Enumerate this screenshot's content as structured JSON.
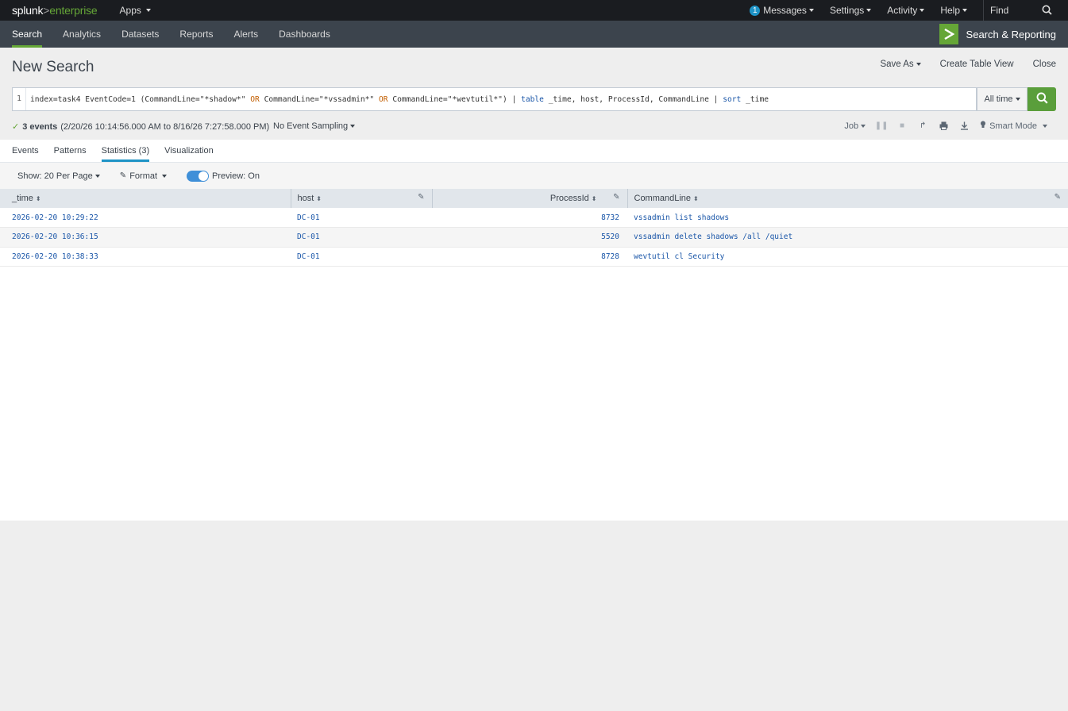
{
  "topbar": {
    "logo_splunk": "splunk",
    "logo_gt": ">",
    "logo_product": "enterprise",
    "apps_label": "Apps",
    "messages_count": "1",
    "messages_label": "Messages",
    "settings_label": "Settings",
    "activity_label": "Activity",
    "help_label": "Help",
    "find_placeholder": "Find"
  },
  "appbar": {
    "tabs": [
      "Search",
      "Analytics",
      "Datasets",
      "Reports",
      "Alerts",
      "Dashboards"
    ],
    "active_tab": "Search",
    "app_name": "Search & Reporting"
  },
  "page": {
    "title": "New Search",
    "save_as": "Save As",
    "create_table_view": "Create Table View",
    "close": "Close"
  },
  "search": {
    "line_number": "1",
    "query_parts": {
      "p1": "index=task4 EventCode=1 (CommandLine=\"*shadow*\" ",
      "or1": "OR",
      "p2": " CommandLine=\"*vssadmin*\" ",
      "or2": "OR",
      "p3": " CommandLine=\"*wevtutil*\") | ",
      "cmd1": "table",
      "p4": " _time, host, ProcessId, CommandLine | ",
      "cmd2": "sort",
      "p5": " _time"
    },
    "time_range": "All time"
  },
  "status": {
    "events_count": "3 events",
    "range": "(2/20/26 10:14:56.000 AM to 8/16/26 7:27:58.000 PM)",
    "sampling": "No Event Sampling",
    "job_label": "Job",
    "mode_label": "Smart Mode"
  },
  "result_tabs": [
    "Events",
    "Patterns",
    "Statistics (3)",
    "Visualization"
  ],
  "active_result_tab": "Statistics (3)",
  "toolbar": {
    "show_per_page": "Show: 20 Per Page",
    "format": "Format",
    "preview": "Preview: On"
  },
  "table": {
    "columns": [
      "_time",
      "host",
      "ProcessId",
      "CommandLine"
    ],
    "rows": [
      [
        "2026-02-20 10:29:22",
        "DC-01",
        "8732",
        "vssadmin list shadows"
      ],
      [
        "2026-02-20 10:36:15",
        "DC-01",
        "5520",
        "vssadmin delete shadows /all /quiet"
      ],
      [
        "2026-02-20 10:38:33",
        "DC-01",
        "8728",
        "wevtutil cl Security"
      ]
    ]
  },
  "colors": {
    "accent_green": "#65a637",
    "accent_blue": "#1e93c6",
    "link_blue": "#1a56a8",
    "keyword_orange": "#c25e00"
  }
}
